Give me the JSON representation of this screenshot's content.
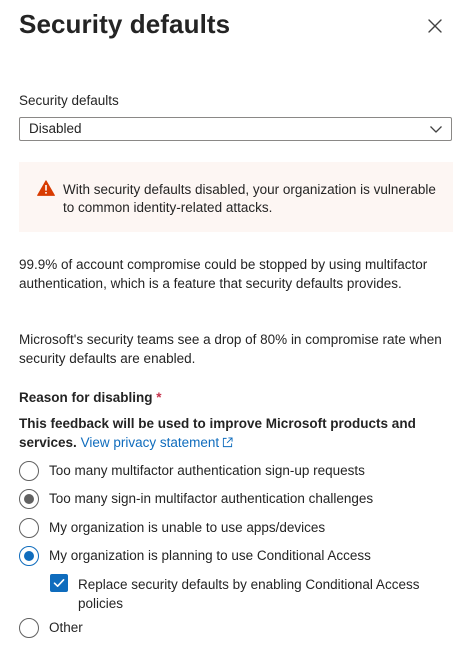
{
  "panel": {
    "title": "Security defaults",
    "close_icon": "close-icon"
  },
  "security_defaults": {
    "label": "Security defaults",
    "selected_value": "Disabled",
    "chevron_icon": "chevron-down-icon"
  },
  "warning": {
    "icon": "warning-icon",
    "text": "With security defaults disabled, your organization is vulnerable to common identity-related attacks.",
    "color": "#d83b01",
    "background": "#fdf6f3"
  },
  "info": {
    "paragraph1": "99.9% of account compromise could be stopped by using multifactor authentication, which is a feature that security defaults provides.",
    "paragraph2": "Microsoft's security teams see a drop of 80% in compromise rate when security defaults are enabled."
  },
  "reason": {
    "title": "Reason for disabling",
    "required_mark": "*",
    "feedback_text": "This feedback will be used to improve Microsoft products and services.",
    "privacy_link": "View privacy statement",
    "options": [
      {
        "label": "Too many multifactor authentication sign-up requests",
        "selected": false
      },
      {
        "label": "Too many sign-in multifactor authentication challenges",
        "selected": false,
        "hover": true
      },
      {
        "label": "My organization is unable to use apps/devices",
        "selected": false
      },
      {
        "label": "My organization is planning to use Conditional Access",
        "selected": true
      },
      {
        "label": "Other",
        "selected": false
      }
    ],
    "conditional_access_checkbox": {
      "label": "Replace security defaults by enabling Conditional Access policies",
      "checked": true
    }
  },
  "colors": {
    "accent": "#0f6cbd",
    "text": "#242424",
    "required": "#c4314b"
  }
}
